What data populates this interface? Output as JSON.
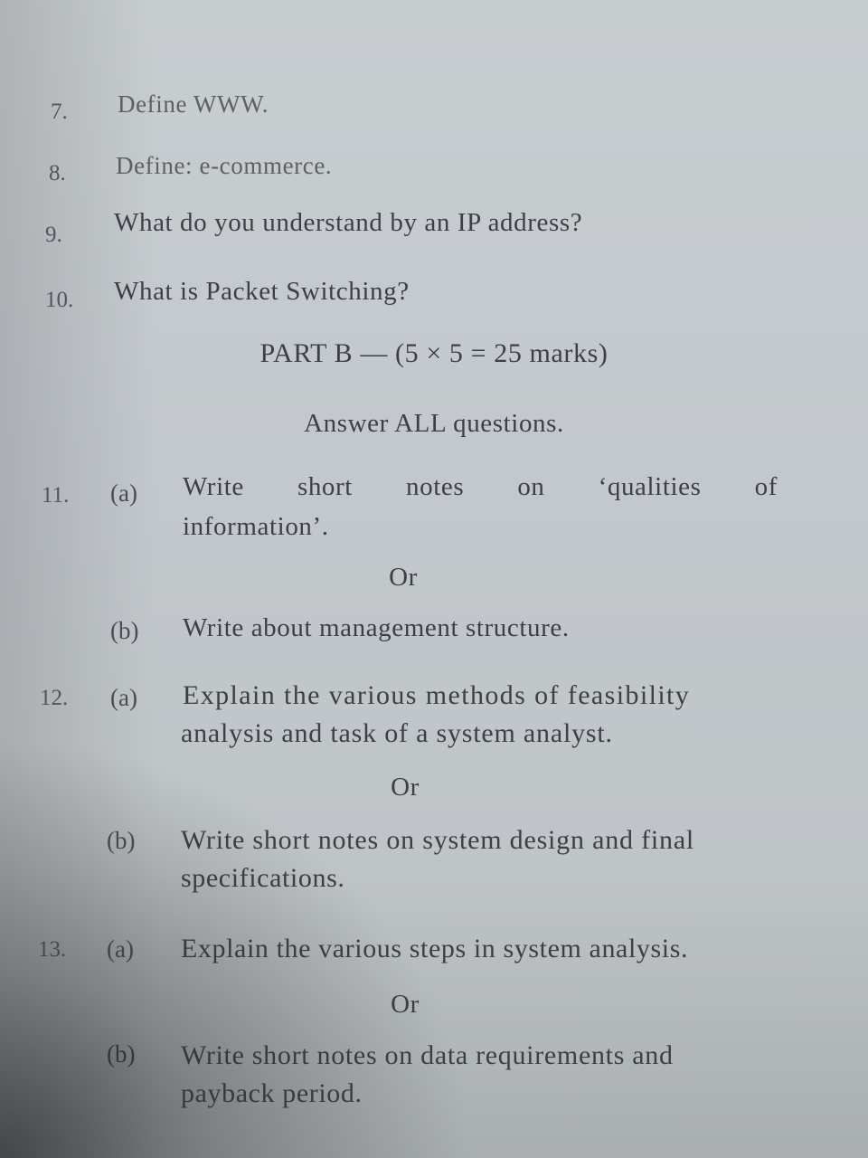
{
  "short_questions": [
    {
      "num": "7.",
      "text": "Define WWW."
    },
    {
      "num": "8.",
      "text": "Define: e-commerce."
    },
    {
      "num": "9.",
      "text": "What do you understand by an IP address?"
    },
    {
      "num": "10.",
      "text": "What is Packet Switching?"
    }
  ],
  "part_b": {
    "heading": "PART B — (5 × 5 = 25 marks)",
    "instruction": "Answer ALL questions."
  },
  "questions": [
    {
      "num": "11.",
      "a_label": "(a)",
      "a_words": [
        "Write",
        "short",
        "notes",
        "on",
        "‘qualities",
        "of"
      ],
      "a_line2": "information’.",
      "or": "Or",
      "b_label": "(b)",
      "b_line1": "Write about management structure."
    },
    {
      "num": "12.",
      "a_label": "(a)",
      "a_line1": "Explain the various methods of feasibility",
      "a_line2": "analysis and task of a system analyst.",
      "or": "Or",
      "b_label": "(b)",
      "b_line1": "Write short notes on system design and final",
      "b_line2": "specifications."
    },
    {
      "num": "13.",
      "a_label": "(a)",
      "a_line1": "Explain the various steps in system analysis.",
      "or": "Or",
      "b_label": "(b)",
      "b_line1": "Write short notes on data requirements and",
      "b_line2": "payback period."
    }
  ]
}
